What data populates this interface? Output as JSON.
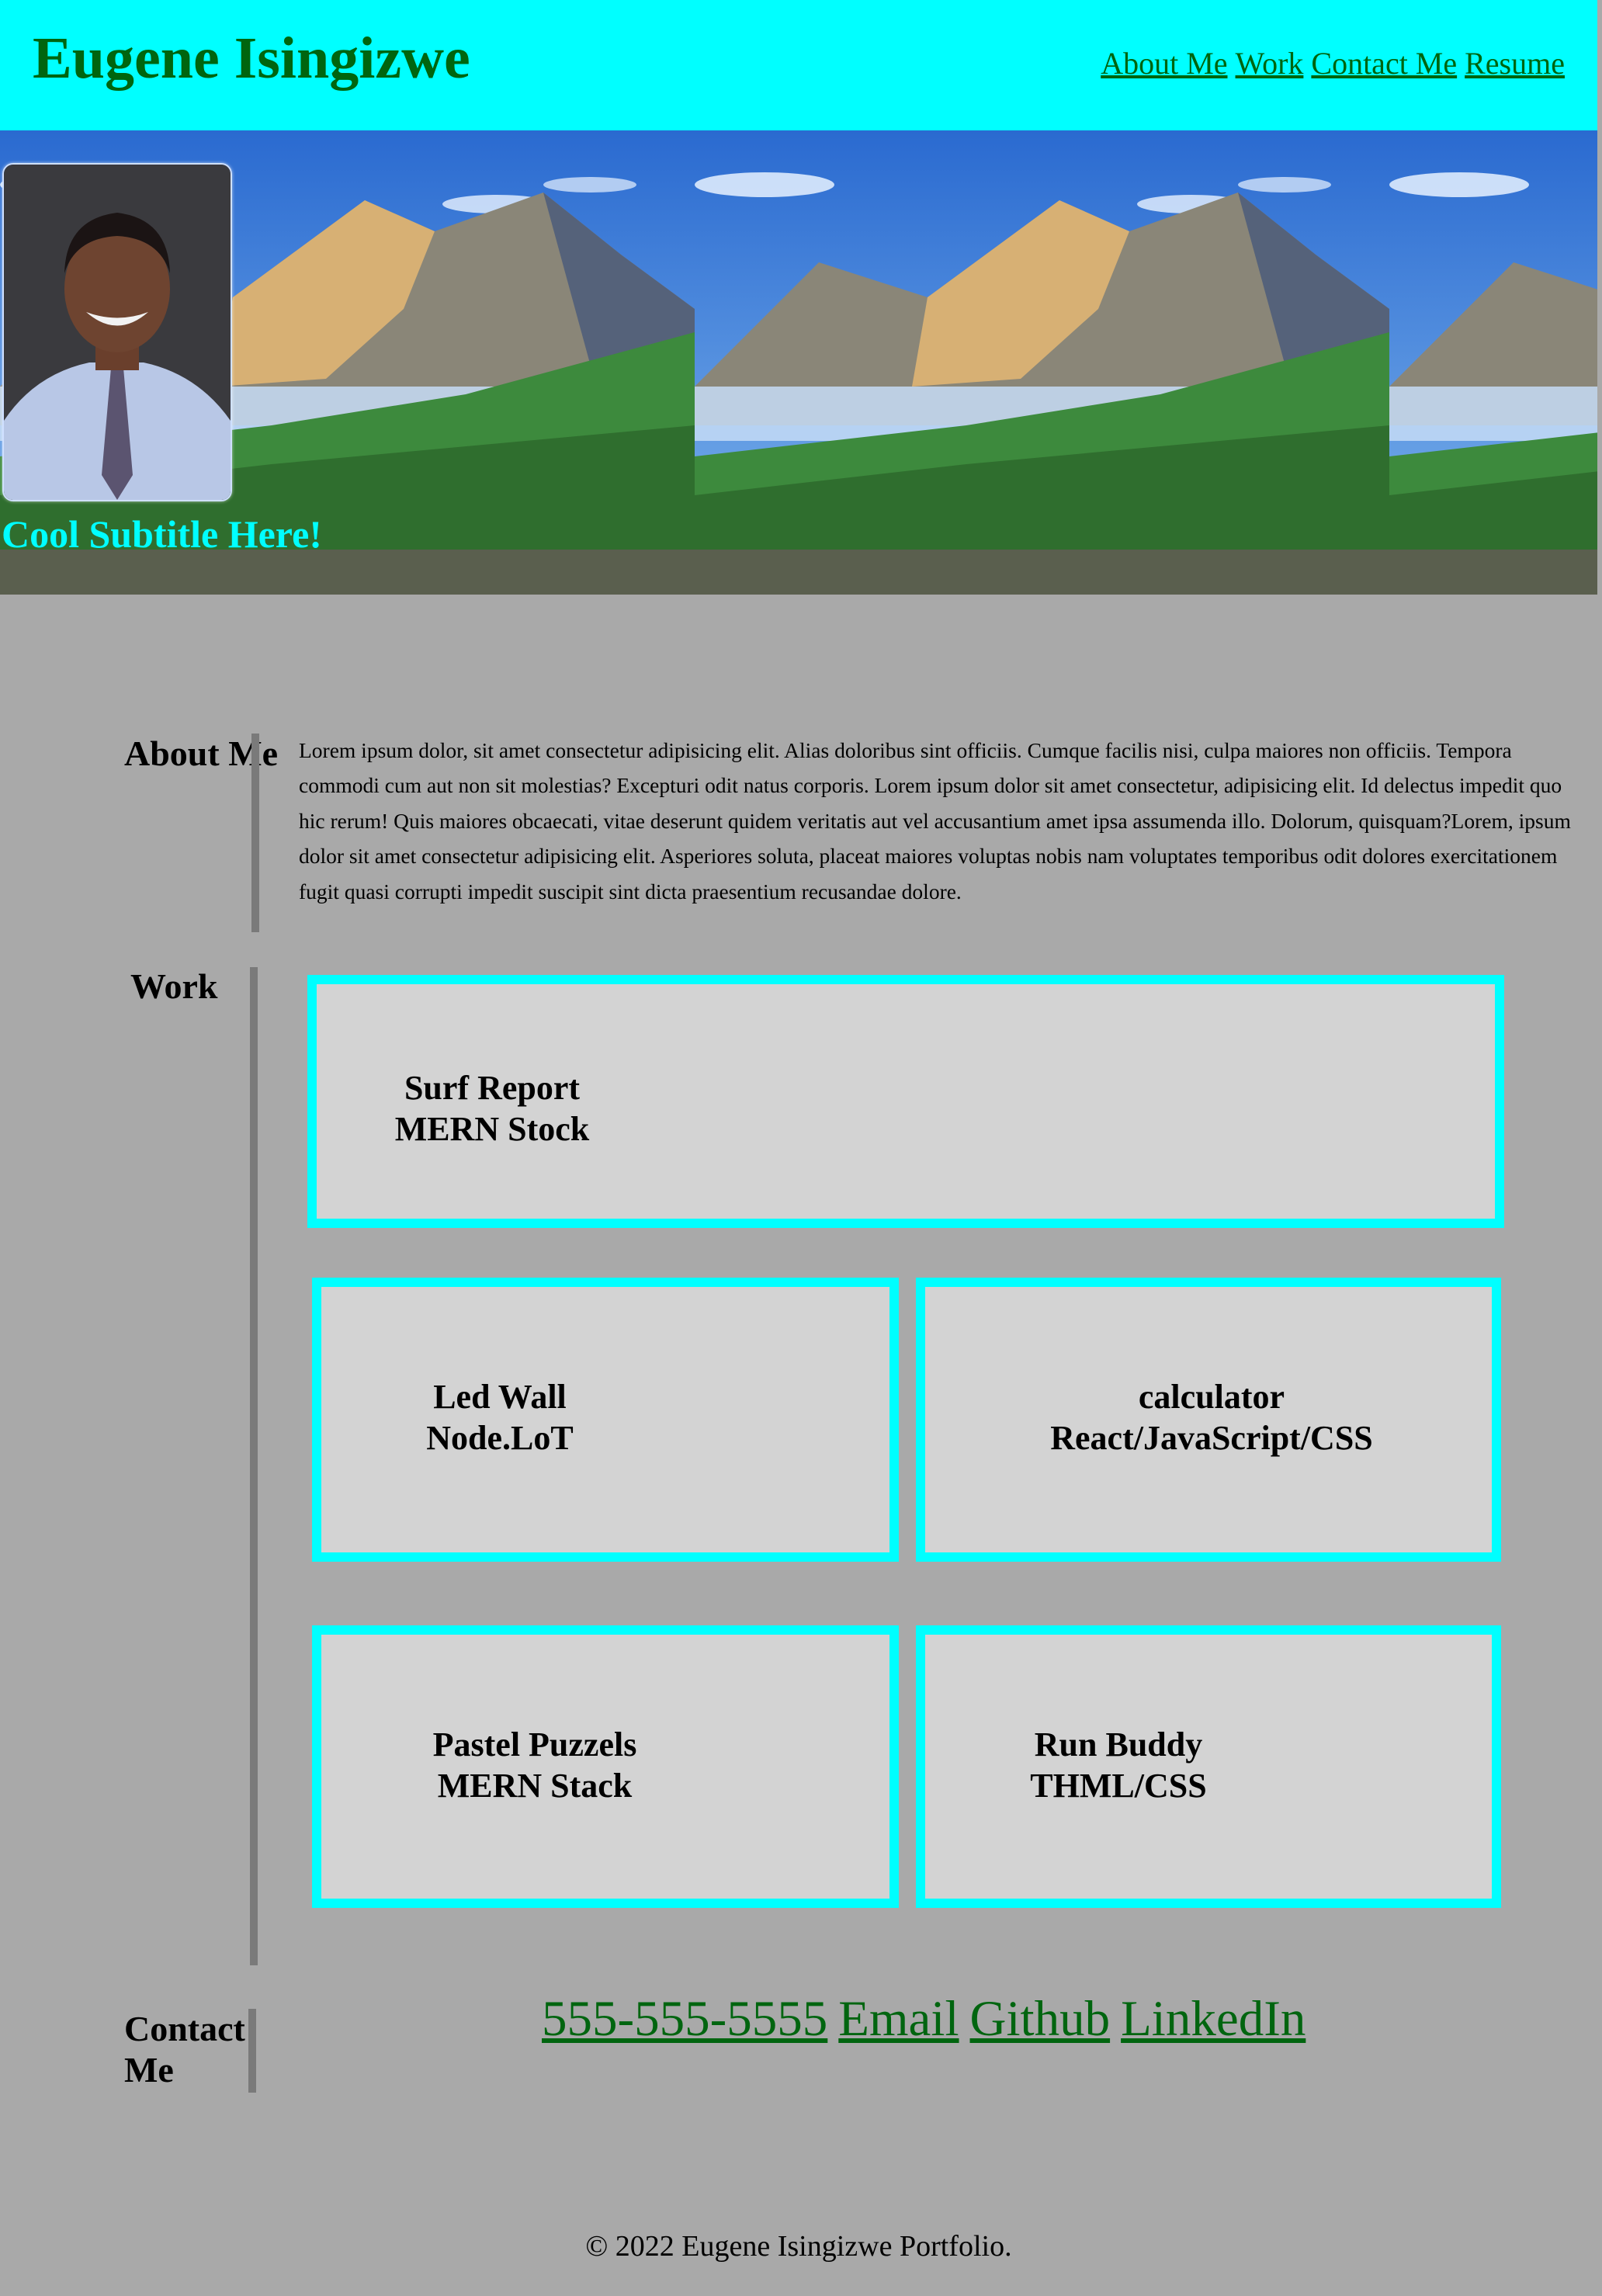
{
  "header": {
    "site_title": "Eugene Isingizwe",
    "nav": [
      "About Me",
      "Work",
      "Contact Me",
      "Resume"
    ]
  },
  "hero": {
    "subtitle": "Cool Subtitle Here!"
  },
  "about": {
    "heading": "About Me",
    "text": "Lorem ipsum dolor, sit amet consectetur adipisicing elit. Alias doloribus sint officiis. Cumque facilis nisi, culpa maiores non officiis. Tempora commodi cum aut non sit molestias? Excepturi odit natus corporis. Lorem ipsum dolor sit amet consectetur, adipisicing elit. Id delectus impedit quo hic rerum! Quis maiores obcaecati, vitae deserunt quidem veritatis aut vel accusantium amet ipsa assumenda illo. Dolorum, quisquam?Lorem, ipsum dolor sit amet consectetur adipisicing elit. Asperiores soluta, placeat maiores voluptas nobis nam voluptates temporibus odit dolores exercitationem fugit quasi corrupti impedit suscipit sint dicta praesentium recusandae dolore."
  },
  "work": {
    "heading": "Work",
    "projects": [
      {
        "title": "Surf Report",
        "stack": "MERN Stock"
      },
      {
        "title": "Led Wall",
        "stack": "Node.LoT"
      },
      {
        "title": "calculator",
        "stack": "React/JavaScript/CSS"
      },
      {
        "title": "Pastel Puzzels",
        "stack": "MERN Stack"
      },
      {
        "title": "Run Buddy",
        "stack": "THML/CSS"
      }
    ]
  },
  "contact": {
    "heading": "Contact Me",
    "links": [
      "555-555-5555",
      "Email",
      "Github",
      "LinkedIn"
    ]
  },
  "footer": {
    "text": "© 2022 Eugene Isingizwe Portfolio."
  },
  "colors": {
    "header_bg": "#00ffff",
    "page_bg": "#a9a9a9",
    "link": "#00650f",
    "card_border": "#00ffff",
    "card_bg": "#d3d3d3",
    "subtitle": "#00ffff"
  },
  "images": {
    "hero_background": "mountain-landscape-image",
    "profile": "profile-photo"
  }
}
